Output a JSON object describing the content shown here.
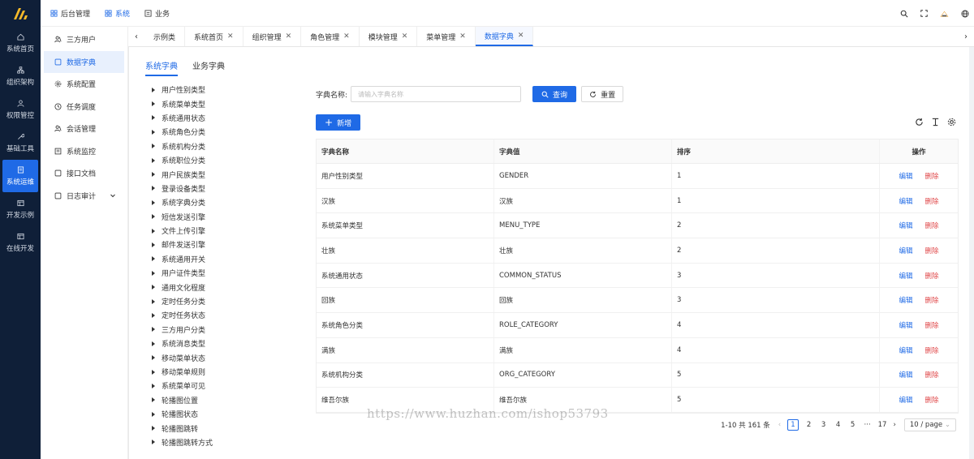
{
  "rail": [
    {
      "label": "系统首页",
      "icon": "home-icon"
    },
    {
      "label": "组织架构",
      "icon": "org-icon"
    },
    {
      "label": "权限管控",
      "icon": "user-icon"
    },
    {
      "label": "基础工具",
      "icon": "wrench-icon"
    },
    {
      "label": "系统运维",
      "icon": "doc-icon",
      "active": true
    },
    {
      "label": "开发示例",
      "icon": "window-icon"
    },
    {
      "label": "在线开发",
      "icon": "window-icon"
    }
  ],
  "topbar": {
    "items": [
      {
        "label": "后台管理"
      },
      {
        "label": "系统",
        "active": true
      },
      {
        "label": "业务"
      }
    ]
  },
  "submenu": [
    {
      "label": "三方用户"
    },
    {
      "label": "数据字典",
      "active": true
    },
    {
      "label": "系统配置"
    },
    {
      "label": "任务调度"
    },
    {
      "label": "会话管理"
    },
    {
      "label": "系统监控"
    },
    {
      "label": "接口文档"
    },
    {
      "label": "日志审计",
      "expandable": true
    }
  ],
  "tabs": [
    {
      "label": "示例类",
      "closable": false
    },
    {
      "label": "系统首页",
      "closable": true
    },
    {
      "label": "组织管理",
      "closable": true
    },
    {
      "label": "角色管理",
      "closable": true
    },
    {
      "label": "模块管理",
      "closable": true
    },
    {
      "label": "菜单管理",
      "closable": true
    },
    {
      "label": "数据字典",
      "closable": true,
      "active": true
    }
  ],
  "dict_tabs": [
    {
      "label": "系统字典",
      "active": true
    },
    {
      "label": "业务字典"
    }
  ],
  "tree": [
    "用户性别类型",
    "系统菜单类型",
    "系统通用状态",
    "系统角色分类",
    "系统机构分类",
    "系统职位分类",
    "用户民族类型",
    "登录设备类型",
    "系统字典分类",
    "短信发送引擎",
    "文件上传引擎",
    "邮件发送引擎",
    "系统通用开关",
    "用户证件类型",
    "通用文化程度",
    "定时任务分类",
    "定时任务状态",
    "三方用户分类",
    "系统消息类型",
    "移动菜单状态",
    "移动菜单规则",
    "系统菜单可见",
    "轮播图位置",
    "轮播图状态",
    "轮播图跳转",
    "轮播图跳转方式"
  ],
  "search": {
    "label": "字典名称:",
    "placeholder": "请输入字典名称",
    "query_label": "查询",
    "reset_label": "重置"
  },
  "add_label": "新增",
  "table": {
    "headers": [
      "字典名称",
      "字典值",
      "排序",
      "操作"
    ],
    "rows": [
      [
        "用户性别类型",
        "GENDER",
        "1"
      ],
      [
        "汉族",
        "汉族",
        "1"
      ],
      [
        "系统菜单类型",
        "MENU_TYPE",
        "2"
      ],
      [
        "壮族",
        "壮族",
        "2"
      ],
      [
        "系统通用状态",
        "COMMON_STATUS",
        "3"
      ],
      [
        "回族",
        "回族",
        "3"
      ],
      [
        "系统角色分类",
        "ROLE_CATEGORY",
        "4"
      ],
      [
        "满族",
        "满族",
        "4"
      ],
      [
        "系统机构分类",
        "ORG_CATEGORY",
        "5"
      ],
      [
        "维吾尔族",
        "维吾尔族",
        "5"
      ]
    ],
    "edit_label": "编辑",
    "delete_label": "删除"
  },
  "pager": {
    "total": "1-10 共 161 条",
    "pages": [
      "1",
      "2",
      "3",
      "4",
      "5",
      "···",
      "17"
    ],
    "current": "1",
    "size": "10 / page"
  },
  "watermark": "https://www.huzhan.com/ishop53793",
  "colors": {
    "primary": "#1f6ae6",
    "danger": "#e0484a",
    "rail": "#0f1f38"
  }
}
